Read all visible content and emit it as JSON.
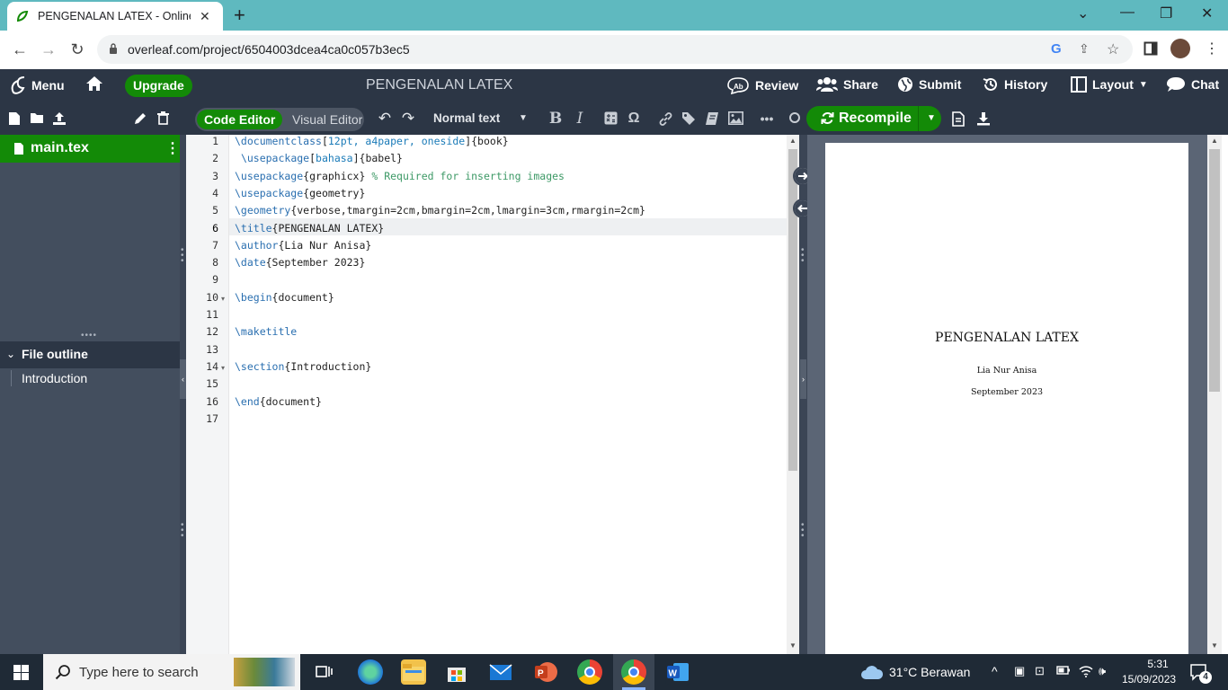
{
  "browser": {
    "tab_title": "PENGENALAN LATEX - Online La",
    "url": "overleaf.com/project/6504003dcea4ca0c057b3ec5"
  },
  "header": {
    "menu": "Menu",
    "upgrade": "Upgrade",
    "project_title": "PENGENALAN LATEX",
    "review": "Review",
    "share": "Share",
    "submit": "Submit",
    "history": "History",
    "layout": "Layout",
    "chat": "Chat"
  },
  "toolbar": {
    "code_editor": "Code Editor",
    "visual_editor": "Visual Editor",
    "normal_text": "Normal text",
    "recompile": "Recompile"
  },
  "sidebar": {
    "file": "main.tex",
    "outline_title": "File outline",
    "outline_items": [
      "Introduction"
    ]
  },
  "editor": {
    "line_numbers": [
      "1",
      "2",
      "3",
      "4",
      "5",
      "6",
      "7",
      "8",
      "9",
      "10",
      "11",
      "12",
      "13",
      "14",
      "15",
      "16",
      "17"
    ],
    "lines": [
      "\\documentclass[12pt, a4paper, oneside]{book}",
      " \\usepackage[bahasa]{babel}",
      "\\usepackage{graphicx} % Required for inserting images",
      "\\usepackage{geometry}",
      "\\geometry{verbose,tmargin=2cm,bmargin=2cm,lmargin=3cm,rmargin=2cm}",
      "\\title{PENGENALAN LATEX}",
      "\\author{Lia Nur Anisa}",
      "\\date{September 2023}",
      "",
      "\\begin{document}",
      "",
      "\\maketitle",
      "",
      "\\section{Introduction}",
      "",
      "\\end{document}",
      ""
    ]
  },
  "pdf": {
    "title": "PENGENALAN LATEX",
    "author": "Lia Nur Anisa",
    "date": "September 2023"
  },
  "taskbar": {
    "search_placeholder": "Type here to search",
    "weather": "31°C  Berawan",
    "time": "5:31",
    "date": "15/09/2023",
    "notifications": "4"
  },
  "colors": {
    "overleaf_green": "#138a07",
    "header_bg": "#2c3645",
    "sidebar_bg": "#434e5e",
    "chrome_tabstrip": "#5fb9bf"
  }
}
